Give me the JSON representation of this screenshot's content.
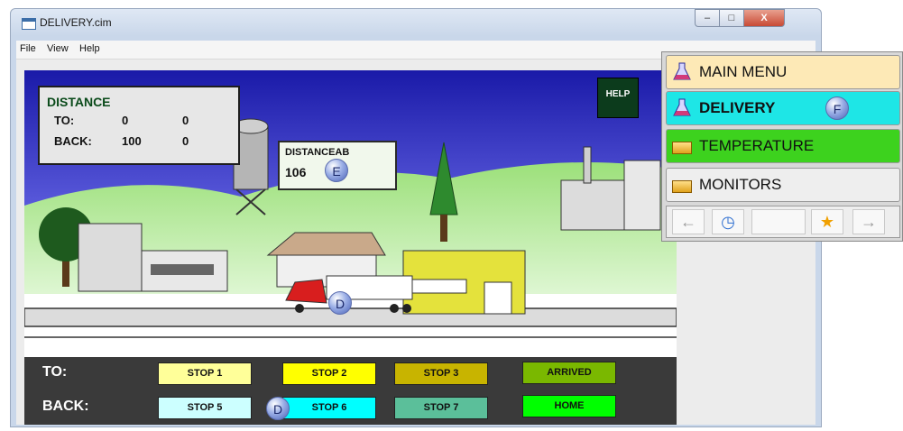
{
  "window": {
    "title": "DELIVERY.cim",
    "minimize_label": "–",
    "maximize_label": "□",
    "close_label": "X"
  },
  "menu": [
    "File",
    "View",
    "Help"
  ],
  "distance": {
    "heading": "DISTANCE",
    "to_label": "TO:",
    "to_value_1": "0",
    "to_value_2": "0",
    "back_label": "BACK:",
    "back_value_1": "100",
    "back_value_2": "0"
  },
  "help_button": "HELP",
  "distance_ab": {
    "label": "DISTANCEAB",
    "value": "106"
  },
  "badges": {
    "e": "E",
    "d": "D",
    "f": "F"
  },
  "controls": {
    "to_label": "TO:",
    "back_label": "BACK:",
    "stops": [
      "STOP 1",
      "STOP 2",
      "STOP 3",
      "STOP 5",
      "STOP 6",
      "STOP 7"
    ],
    "arrived": "ARRIVED",
    "home": "HOME"
  },
  "nav_panel": {
    "items": [
      "MAIN MENU",
      "DELIVERY",
      "TEMPERATURE",
      "MONITORS"
    ],
    "back_icon": "←",
    "forward_icon": "→",
    "star_icon": "★",
    "clock_icon": "◷"
  },
  "colors": {
    "stop1": "#ffff99",
    "stop2": "#ffff00",
    "stop3": "#c8b400",
    "stop5": "#ccffff",
    "stop6": "#00ffff",
    "stop7": "#5bbf9a",
    "arrived": "#7ab800",
    "home": "#00ff00",
    "main_menu": "#fde9b6",
    "delivery": "#1ee6e6",
    "temperature": "#3dd21e",
    "monitors": "#eeeeee"
  }
}
